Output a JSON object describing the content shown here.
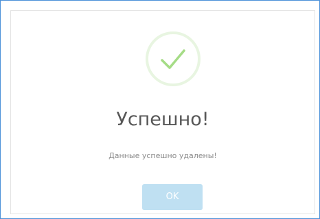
{
  "dialog": {
    "icon": "success-check-icon",
    "title": "Успешно!",
    "message": "Данные успешно удалены!",
    "ok_label": "OK"
  },
  "colors": {
    "frame_border": "#4a90d9",
    "check": "#a5dc86",
    "ring": "#e8f5e1",
    "title": "#575757",
    "message": "#8a8a8a",
    "button": "#bfe0f2"
  }
}
